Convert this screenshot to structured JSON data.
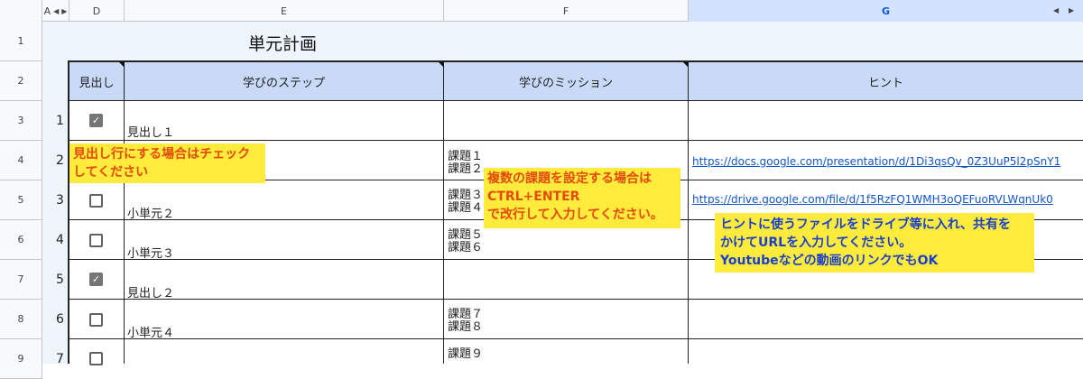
{
  "columns": {
    "a": "A",
    "d": "D",
    "e": "E",
    "f": "F",
    "g": "G"
  },
  "row_numbers": [
    "1",
    "2",
    "3",
    "4",
    "5",
    "6",
    "7",
    "8",
    "9"
  ],
  "title": "単元計画",
  "headers": {
    "midashi": "見出し",
    "step": "学びのステップ",
    "mission": "学びのミッション",
    "hint": "ヒント"
  },
  "rows": [
    {
      "no": "1",
      "checked": true,
      "step": "見出し１",
      "mission": "",
      "hint": ""
    },
    {
      "no": "2",
      "checked": null,
      "step": "",
      "mission": "課題１\n課題２",
      "hint": "https://docs.google.com/presentation/d/1Di3qsQv_0Z3UuP5l2pSnY1"
    },
    {
      "no": "3",
      "checked": false,
      "step": "小単元２",
      "mission": "課題３\n課題４",
      "hint": "https://drive.google.com/file/d/1f5RzFQ1WMH3oQEFuoRVLWqnUk0"
    },
    {
      "no": "4",
      "checked": false,
      "step": "小単元３",
      "mission": "課題５\n課題６",
      "hint": ""
    },
    {
      "no": "5",
      "checked": true,
      "step": "見出し２",
      "mission": "",
      "hint": ""
    },
    {
      "no": "6",
      "checked": false,
      "step": "小単元４",
      "mission": "課題７\n課題８",
      "hint": ""
    },
    {
      "no": "7",
      "checked": false,
      "step": "",
      "mission": "課題９",
      "hint": ""
    }
  ],
  "notes": {
    "check": "見出し行にする場合はチェック\nしてください",
    "multi": "複数の課題を設定する場合は\nCTRL+ENTER\nで改行して入力してください。",
    "hint": "ヒントに使うファイルをドライブ等に入れ、共有を\nかけてURLを入力してください。\nYoutubeなどの動画のリンクでもOK"
  },
  "colors": {
    "header_fill": "#c9daf8",
    "note_fill": "#ffeb3b",
    "note_text_red": "#e34a0b",
    "note_text_blue": "#1a3fcc",
    "link": "#1155cc"
  }
}
